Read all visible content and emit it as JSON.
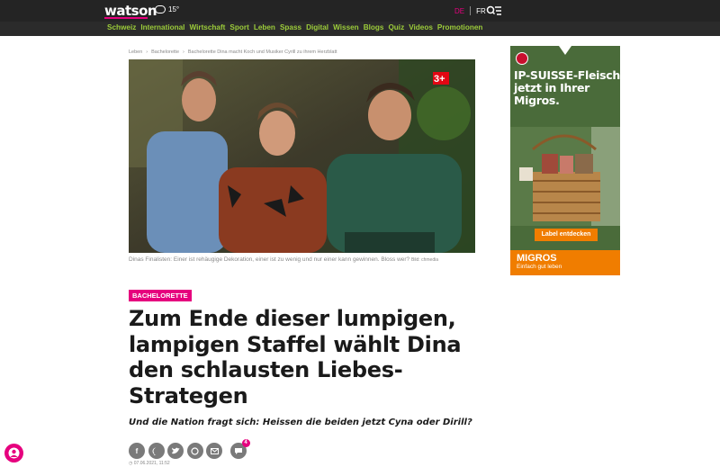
{
  "header": {
    "logo": "watson",
    "temperature": "15°",
    "lang_de": "DE",
    "lang_fr": "FR"
  },
  "nav": {
    "items": [
      "Schweiz",
      "International",
      "Wirtschaft",
      "Sport",
      "Leben",
      "Spass",
      "Digital",
      "Wissen",
      "Blogs",
      "Quiz",
      "Videos",
      "Promotionen"
    ]
  },
  "breadcrumb": [
    "Leben",
    "Bachelorette",
    "Bachelorette Dina macht Koch und Musiker Cyrill zu ihrem Herzblatt"
  ],
  "hero": {
    "channel_badge": "3+",
    "caption": "Dinas Finalisten: Einer ist rehäugige Dekoration, einer ist zu wenig und nur einer kann gewinnen. Bloss wer?",
    "credit": "Bild: chmedia"
  },
  "article": {
    "tag": "BACHELORETTE",
    "headline": "Zum Ende dieser lumpigen, lampigen Staffel wählt Dina den schlausten Liebes-Strategen",
    "lead": "Und die Nation fragt sich: Heissen die beiden jetzt Cyna oder Dirill?",
    "comment_count": "4",
    "date": "07.06.2021, 11:52"
  },
  "share_icons": [
    "facebook-icon",
    "messenger-icon",
    "twitter-icon",
    "whatsapp-icon",
    "email-icon"
  ],
  "ad": {
    "title": "IP-SUISSE-Fleisch jetzt in Ihrer Migros.",
    "button": "Label entdecken",
    "brand": "MIGROS",
    "slogan": "Einfach gut leben"
  },
  "colors": {
    "accent": "#e6007e",
    "nav_green": "#9ccc3a",
    "topbar": "#242424",
    "ad_orange": "#f07d00"
  }
}
